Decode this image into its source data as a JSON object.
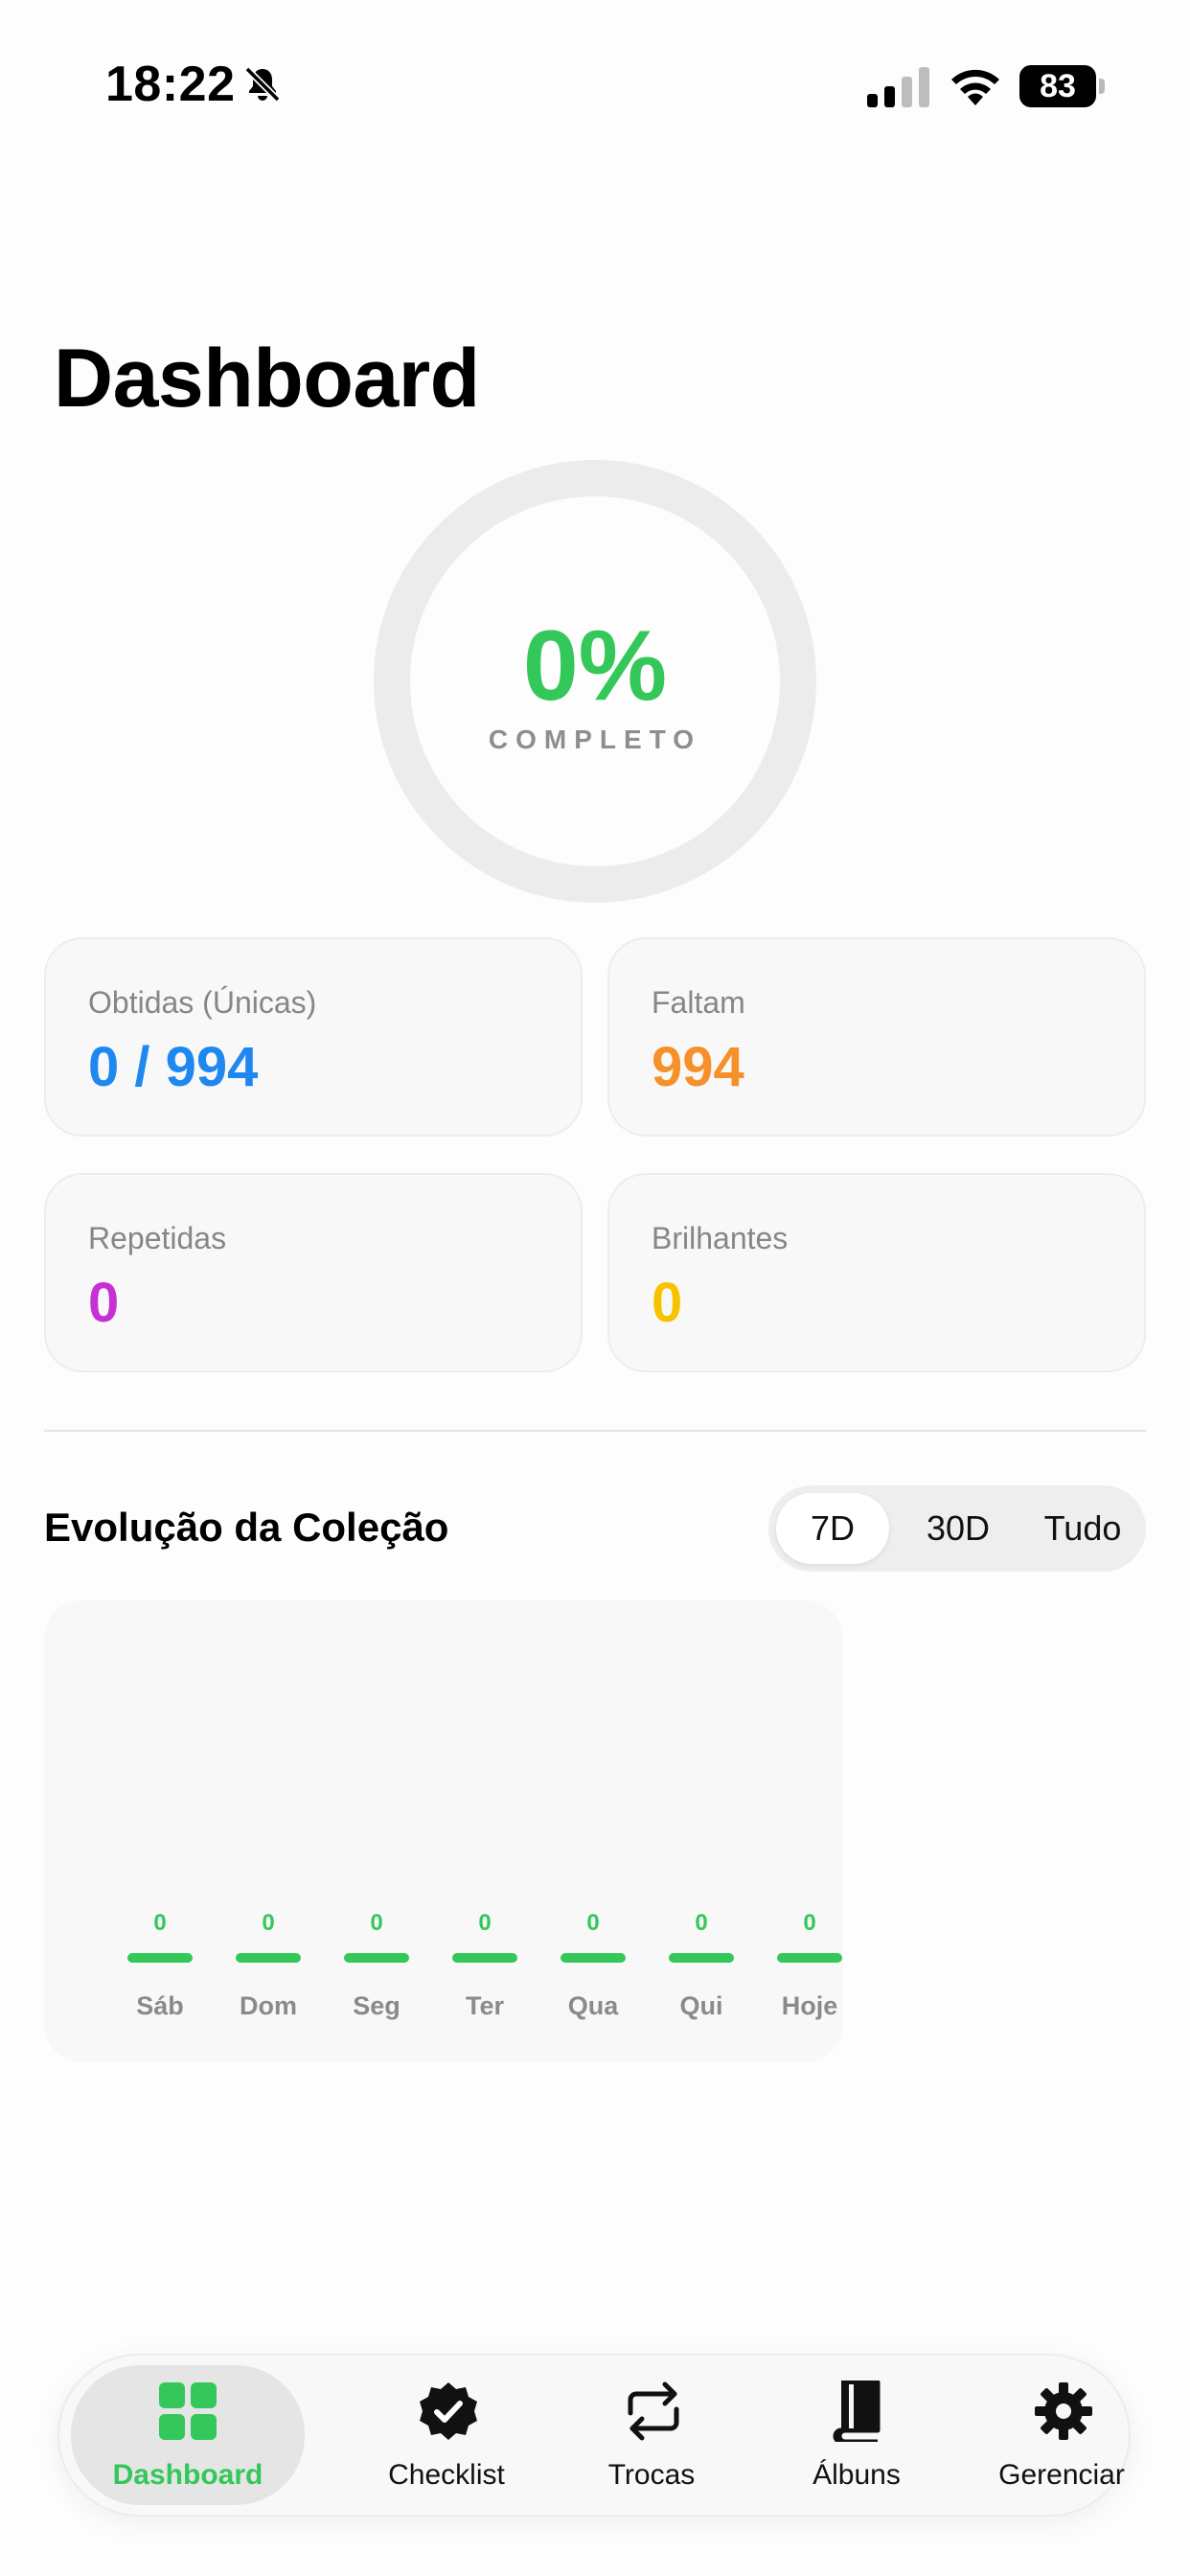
{
  "status_bar": {
    "time": "18:22",
    "battery": "83"
  },
  "page_title": "Dashboard",
  "progress": {
    "percent_text": "0%",
    "label": "COMPLETO",
    "fraction": 0
  },
  "stats": [
    {
      "label": "Obtidas (Únicas)",
      "value": "0 / 994",
      "color": "#1e88f0"
    },
    {
      "label": "Faltam",
      "value": "994",
      "color": "#f5902a"
    },
    {
      "label": "Repetidas",
      "value": "0",
      "color": "#c630d4"
    },
    {
      "label": "Brilhantes",
      "value": "0",
      "color": "#f7c300"
    }
  ],
  "evolution": {
    "title": "Evolução da Coleção",
    "ranges": [
      "7D",
      "30D",
      "Tudo"
    ],
    "selected_range": "7D"
  },
  "chart_data": {
    "type": "bar",
    "categories": [
      "Sáb",
      "Dom",
      "Seg",
      "Ter",
      "Qua",
      "Qui",
      "Hoje"
    ],
    "values": [
      0,
      0,
      0,
      0,
      0,
      0,
      0
    ],
    "color": "#34c759"
  },
  "tabbar": {
    "items": [
      {
        "label": "Dashboard",
        "icon": "grid-icon"
      },
      {
        "label": "Checklist",
        "icon": "verified-badge-icon"
      },
      {
        "label": "Trocas",
        "icon": "swap-arrows-icon"
      },
      {
        "label": "Álbuns",
        "icon": "book-icon"
      },
      {
        "label": "Gerenciar",
        "icon": "gear-icon"
      }
    ],
    "active_color": "#34c759"
  }
}
